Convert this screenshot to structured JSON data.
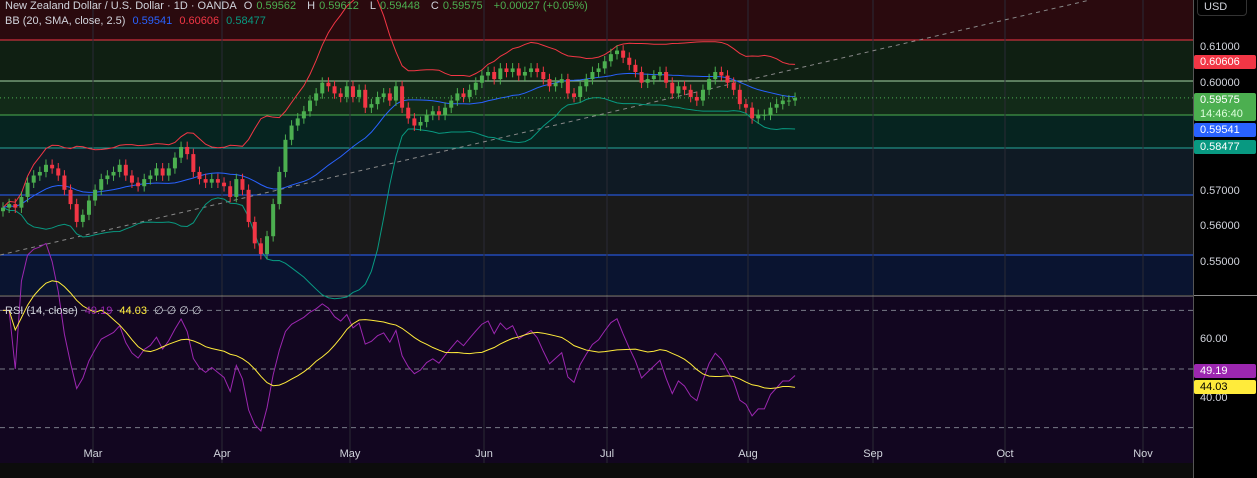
{
  "header": {
    "symbol": "New Zealand Dollar / U.S. Dollar · 1D · OANDA",
    "o_label": "O",
    "o": "0.59562",
    "h_label": "H",
    "h": "0.59612",
    "l_label": "L",
    "l": "0.59448",
    "c_label": "C",
    "c": "0.59575",
    "change": "+0.00027 (+0.05%)"
  },
  "bb": {
    "label": "BB (20, SMA, close, 2.5)",
    "basis": "0.59541",
    "upper": "0.60606",
    "lower": "0.58477"
  },
  "rsi": {
    "label": "RSI (14, close)",
    "value": "49.19",
    "ma": "44.03",
    "extra": "∅ ∅ ∅ ∅"
  },
  "axis": {
    "currency": "USD",
    "price_ticks": [
      "0.61000",
      "0.60000",
      "0.57000",
      "0.56000",
      "0.55000"
    ],
    "rsi_ticks": [
      "60.00",
      "40.00"
    ],
    "tags": {
      "upper": "0.60606",
      "last": "0.59575",
      "countdown": "14:46:40",
      "basis": "0.59541",
      "lower": "0.58477",
      "rsi": "49.19",
      "rsi_ma": "44.03"
    }
  },
  "colors": {
    "up": "#4caf50",
    "down": "#f23645",
    "bb_basis": "#2962ff",
    "bb_upper": "#f23645",
    "bb_lower": "#089981",
    "rsi": "#9c27b0",
    "rsi_ma": "#ffeb3b"
  },
  "chart_data": {
    "type": "candlestick",
    "months": [
      "Mar",
      "Apr",
      "May",
      "Jun",
      "Jul",
      "Aug",
      "Sep",
      "Oct",
      "Nov"
    ],
    "ylim": [
      0.542,
      0.622
    ],
    "rsi_levels": [
      70,
      50,
      30
    ],
    "closes": [
      0.565,
      0.566,
      0.565,
      0.568,
      0.572,
      0.574,
      0.575,
      0.577,
      0.576,
      0.574,
      0.57,
      0.566,
      0.561,
      0.563,
      0.567,
      0.57,
      0.573,
      0.574,
      0.575,
      0.577,
      0.574,
      0.572,
      0.571,
      0.573,
      0.574,
      0.576,
      0.574,
      0.576,
      0.579,
      0.582,
      0.58,
      0.575,
      0.573,
      0.572,
      0.573,
      0.572,
      0.571,
      0.568,
      0.573,
      0.57,
      0.561,
      0.555,
      0.552,
      0.557,
      0.566,
      0.575,
      0.584,
      0.588,
      0.59,
      0.592,
      0.595,
      0.597,
      0.6,
      0.599,
      0.597,
      0.596,
      0.599,
      0.596,
      0.598,
      0.593,
      0.594,
      0.596,
      0.597,
      0.595,
      0.599,
      0.593,
      0.59,
      0.588,
      0.589,
      0.591,
      0.592,
      0.591,
      0.593,
      0.595,
      0.597,
      0.596,
      0.598,
      0.6,
      0.602,
      0.603,
      0.601,
      0.604,
      0.603,
      0.604,
      0.602,
      0.603,
      0.604,
      0.603,
      0.601,
      0.599,
      0.6,
      0.601,
      0.597,
      0.596,
      0.599,
      0.601,
      0.603,
      0.604,
      0.606,
      0.608,
      0.609,
      0.607,
      0.605,
      0.603,
      0.6,
      0.601,
      0.602,
      0.603,
      0.6,
      0.597,
      0.599,
      0.598,
      0.596,
      0.595,
      0.598,
      0.601,
      0.603,
      0.602,
      0.6,
      0.598,
      0.594,
      0.593,
      0.59,
      0.591,
      0.591,
      0.593,
      0.594,
      0.595,
      0.595,
      0.59575
    ]
  }
}
